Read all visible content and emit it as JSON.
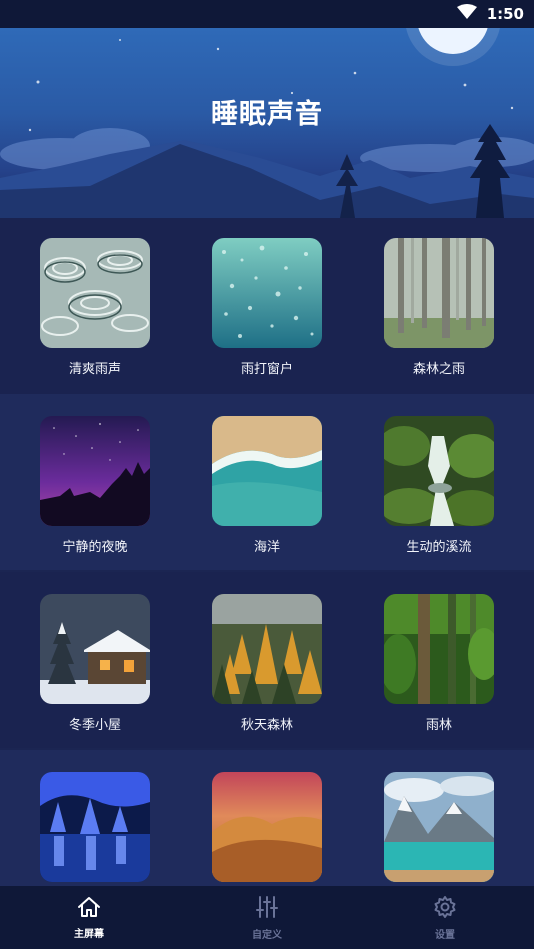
{
  "status_bar": {
    "time": "1:50"
  },
  "header": {
    "title": "睡眠声音"
  },
  "sounds": [
    {
      "label": "清爽雨声",
      "icon": "rain-ripples-image"
    },
    {
      "label": "雨打窗户",
      "icon": "rain-window-image"
    },
    {
      "label": "森林之雨",
      "icon": "foggy-forest-image"
    },
    {
      "label": "宁静的夜晚",
      "icon": "starry-night-image"
    },
    {
      "label": "海洋",
      "icon": "ocean-beach-image"
    },
    {
      "label": "生动的溪流",
      "icon": "forest-stream-image"
    },
    {
      "label": "冬季小屋",
      "icon": "winter-cabin-image"
    },
    {
      "label": "秋天森林",
      "icon": "autumn-forest-image"
    },
    {
      "label": "雨林",
      "icon": "rainforest-image"
    },
    {
      "label": "",
      "icon": "blue-cave-image"
    },
    {
      "label": "",
      "icon": "desert-dunes-image"
    },
    {
      "label": "",
      "icon": "mountain-lake-image"
    }
  ],
  "bottom_nav": [
    {
      "label": "主屏幕",
      "icon": "home-icon",
      "active": true
    },
    {
      "label": "自定义",
      "icon": "sliders-icon",
      "active": false
    },
    {
      "label": "设置",
      "icon": "gear-icon",
      "active": false
    }
  ],
  "colors": {
    "background": "#1b2552",
    "nav": "#0f1838",
    "header": "#2a5aa5"
  }
}
